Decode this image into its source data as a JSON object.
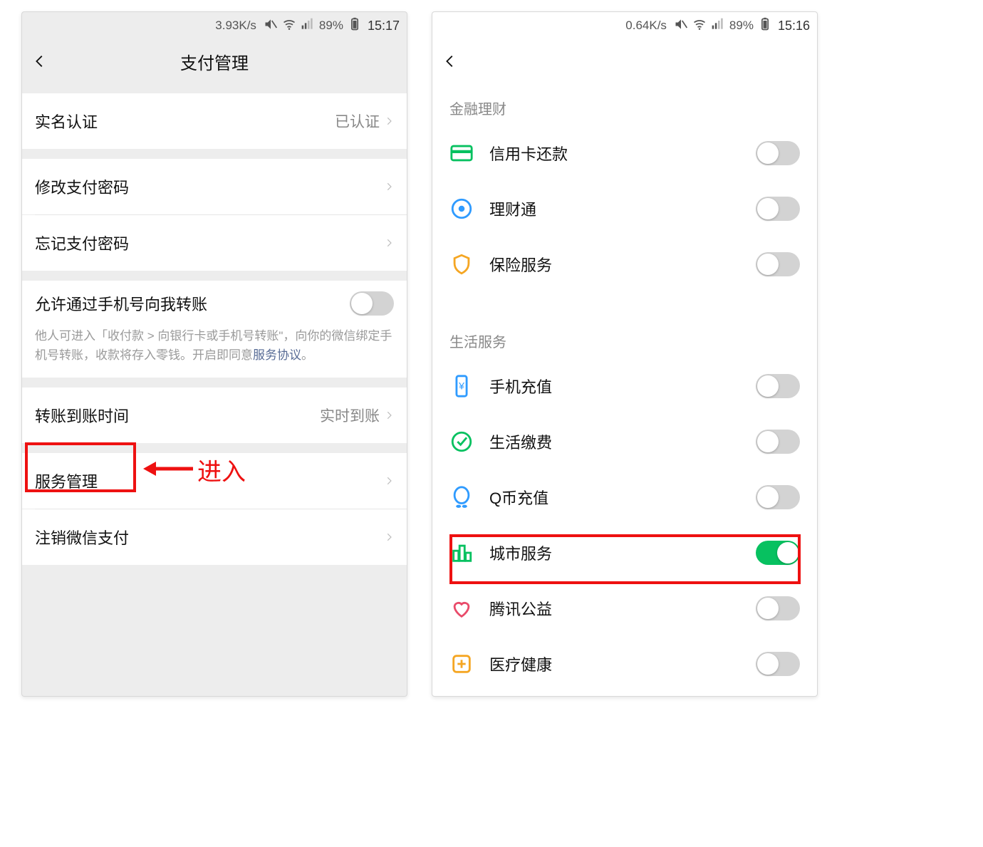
{
  "left": {
    "status": {
      "speed": "3.93K/s",
      "battery": "89%",
      "time": "15:17"
    },
    "nav": {
      "title": "支付管理"
    },
    "rows": {
      "realname": {
        "label": "实名认证",
        "value": "已认证"
      },
      "changepwd": {
        "label": "修改支付密码"
      },
      "forgotpwd": {
        "label": "忘记支付密码"
      },
      "allow_phone": {
        "label": "允许通过手机号向我转账",
        "desc1": "他人可进入「收付款 > 向银行卡或手机号转账\"，向你的微信绑定手机号转账，收款将存入零钱。开启即同意",
        "link": "服务协议",
        "desc_tail": "。"
      },
      "arrive": {
        "label": "转账到账时间",
        "value": "实时到账"
      },
      "service": {
        "label": "服务管理"
      },
      "cancel": {
        "label": "注销微信支付"
      }
    },
    "annotation": {
      "text": "进入"
    }
  },
  "right": {
    "status": {
      "speed": "0.64K/s",
      "battery": "89%",
      "time": "15:16"
    },
    "sections": {
      "finance": {
        "title": "金融理财",
        "items": [
          {
            "key": "credit",
            "label": "信用卡还款",
            "on": false
          },
          {
            "key": "licaitong",
            "label": "理财通",
            "on": false
          },
          {
            "key": "insurance",
            "label": "保险服务",
            "on": false
          }
        ]
      },
      "life": {
        "title": "生活服务",
        "items": [
          {
            "key": "topup",
            "label": "手机充值",
            "on": false
          },
          {
            "key": "bills",
            "label": "生活缴费",
            "on": false
          },
          {
            "key": "qcoin",
            "label": "Q币充值",
            "on": false
          },
          {
            "key": "city",
            "label": "城市服务",
            "on": true
          },
          {
            "key": "charity",
            "label": "腾讯公益",
            "on": false
          },
          {
            "key": "health",
            "label": "医疗健康",
            "on": false
          }
        ]
      }
    }
  }
}
